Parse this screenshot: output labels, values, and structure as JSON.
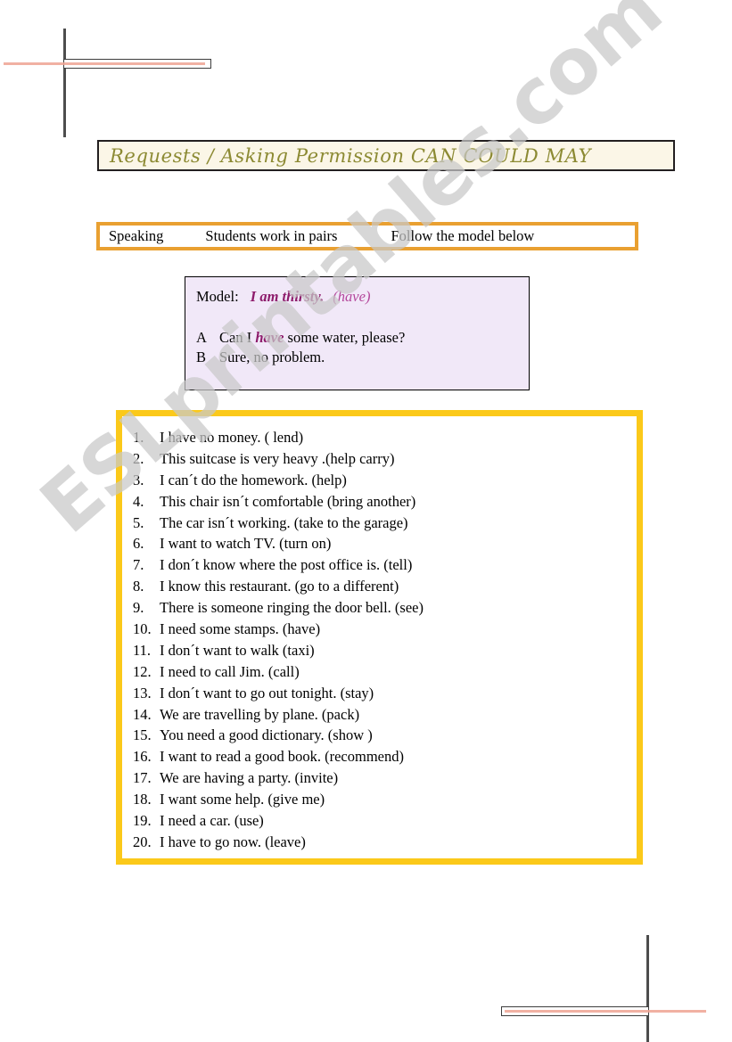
{
  "title": {
    "text": "Requests / Asking Permission  CAN  COULD  MAY"
  },
  "instruction_bar": {
    "skill": "Speaking",
    "grouping": "Students work in pairs",
    "direction": "Follow the model below"
  },
  "model": {
    "label": "Model:",
    "prompt": "I am thirsty.",
    "cue": "(have)",
    "lines": [
      {
        "speaker": "A",
        "before": "Can I ",
        "keyword": "have",
        "after": " some water, please?"
      },
      {
        "speaker": "B",
        "before": "Sure, no problem.",
        "keyword": "",
        "after": ""
      }
    ]
  },
  "exercises": [
    {
      "num": "1.",
      "text": "I have no money. ( lend)"
    },
    {
      "num": "2.",
      "text": "This suitcase is very heavy .(help carry)"
    },
    {
      "num": "3.",
      "text": "I can´t do the homework. (help)"
    },
    {
      "num": "4.",
      "text": "This chair isn´t comfortable (bring another)"
    },
    {
      "num": "5.",
      "text": "The car isn´t working. (take to the garage)"
    },
    {
      "num": "6.",
      "text": "I want to watch TV. (turn on)"
    },
    {
      "num": "7.",
      "text": "I don´t know where the post office is. (tell)"
    },
    {
      "num": "8.",
      "text": "I know this restaurant. (go to a different)"
    },
    {
      "num": "9.",
      "text": "There is someone ringing the door bell. (see)"
    },
    {
      "num": "10.",
      "text": "I need some stamps. (have)"
    },
    {
      "num": "11.",
      "text": "I don´t want to walk (taxi)"
    },
    {
      "num": "12.",
      "text": "I need to call Jim. (call)"
    },
    {
      "num": "13.",
      "text": "I don´t want to go out tonight. (stay)"
    },
    {
      "num": "14.",
      "text": "We are travelling by plane. (pack)"
    },
    {
      "num": "15.",
      "text": "You need a good dictionary. (show )"
    },
    {
      "num": "16.",
      "text": "I want to read a good book. (recommend)"
    },
    {
      "num": "17.",
      "text": "We are having a party. (invite)"
    },
    {
      "num": "18.",
      "text": "I  want some help. (give me)"
    },
    {
      "num": "19.",
      "text": "I need a car. (use)"
    },
    {
      "num": "20.",
      "text": "I have to go now. (leave)"
    }
  ],
  "watermark": {
    "text": "ESLprintables.com"
  },
  "colors": {
    "title_text": "#8c8a33",
    "title_background": "#fbf6e7",
    "instruction_border": "#e9a031",
    "model_background": "#f1e8f8",
    "model_prompt": "#8d1b6b",
    "model_cue": "#b4479b",
    "list_border": "#fbc91a",
    "watermark": "#c9c9c9",
    "crop_mark_line": "#4d4d4d",
    "crop_mark_pink": "#efa393"
  }
}
